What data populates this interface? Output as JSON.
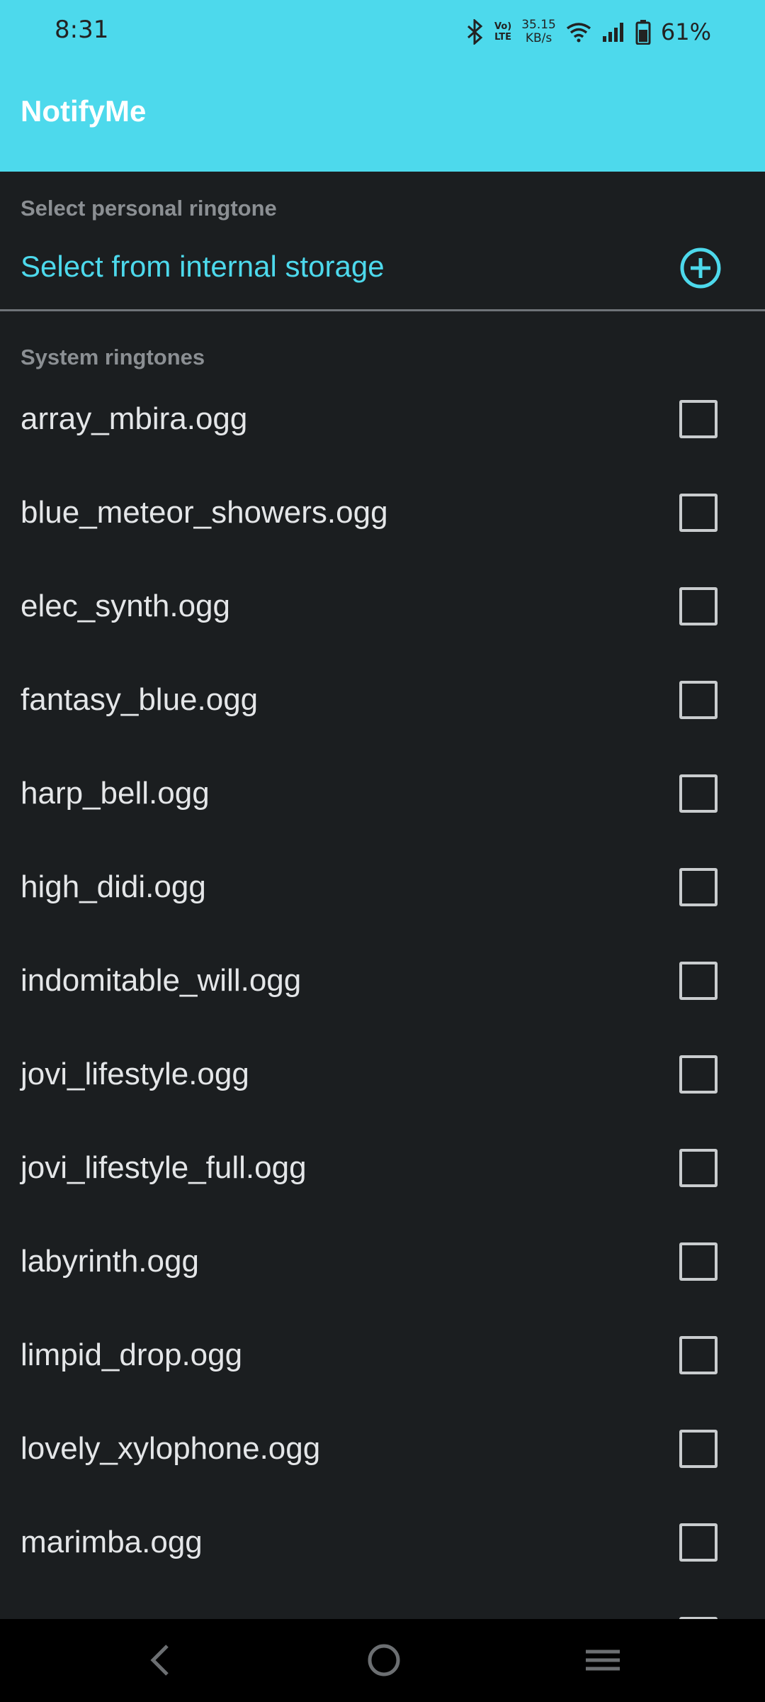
{
  "status_bar": {
    "time": "8:31",
    "lte_top": "Vo)",
    "lte_bottom": "LTE",
    "speed_value": "35.15",
    "speed_unit": "KB/s",
    "battery": "61%"
  },
  "app": {
    "title": "NotifyMe"
  },
  "personal": {
    "section_label": "Select personal ringtone",
    "select_label": "Select from internal storage"
  },
  "system": {
    "section_label": "System ringtones",
    "ringtones": [
      "array_mbira.ogg",
      "blue_meteor_showers.ogg",
      "elec_synth.ogg",
      "fantasy_blue.ogg",
      "harp_bell.ogg",
      "high_didi.ogg",
      "indomitable_will.ogg",
      "jovi_lifestyle.ogg",
      "jovi_lifestyle_full.ogg",
      "labyrinth.ogg",
      "limpid_drop.ogg",
      "lovely_xylophone.ogg",
      "marimba.ogg",
      ""
    ]
  },
  "colors": {
    "accent": "#4dd9ec",
    "background": "#1b1e20",
    "text": "#e4e6e8",
    "muted": "#8b8f93"
  },
  "icons": {
    "add": "add-circle-icon",
    "checkbox": "checkbox-unchecked",
    "nav_back": "back-icon",
    "nav_home": "home-icon",
    "nav_menu": "menu-icon"
  }
}
